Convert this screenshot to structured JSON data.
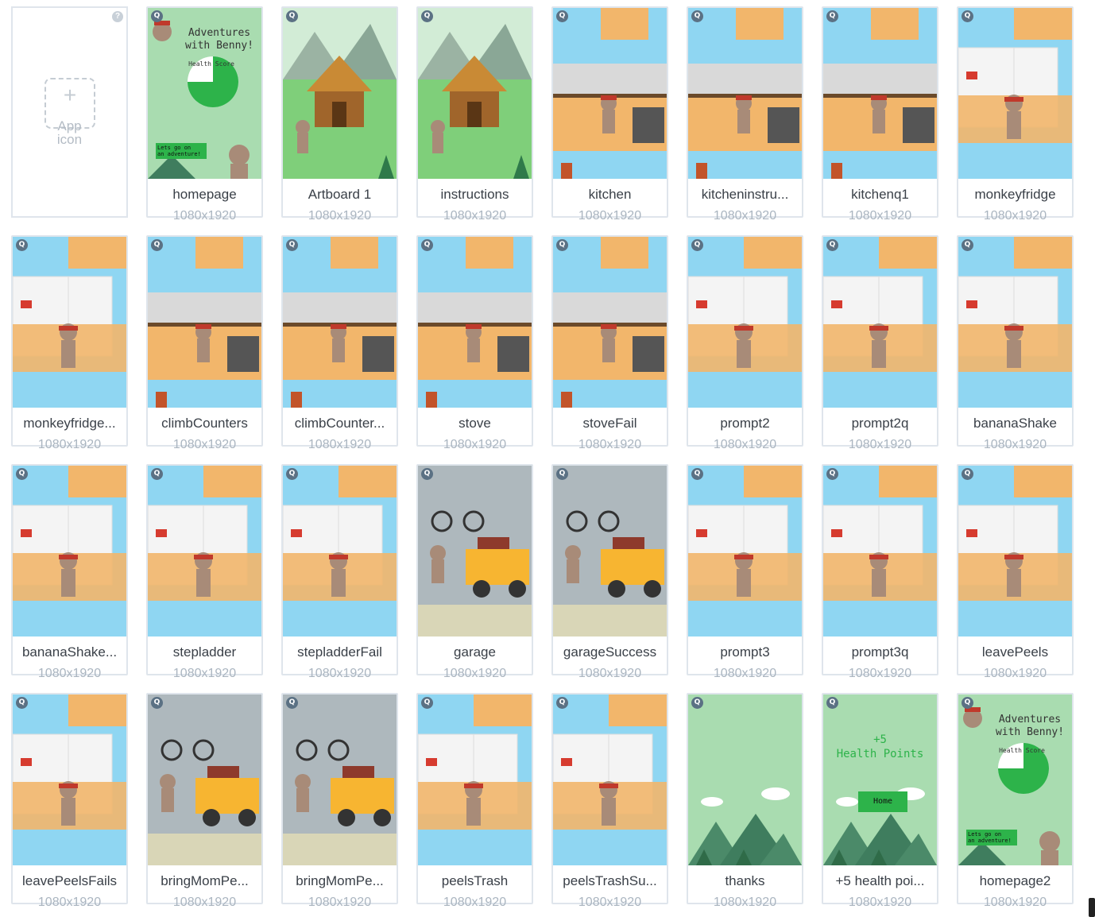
{
  "app_icon": {
    "label_line1": "App",
    "label_line2": "icon",
    "help": "?",
    "plus": "+"
  },
  "badge": "Q",
  "size_label": "1080x1920",
  "screens": [
    {
      "name": "homepage",
      "scene": "title"
    },
    {
      "name": "Artboard 1",
      "scene": "hut"
    },
    {
      "name": "instructions",
      "scene": "hut"
    },
    {
      "name": "kitchen",
      "scene": "kitchen"
    },
    {
      "name": "kitcheninstru...",
      "scene": "kitchen"
    },
    {
      "name": "kitchenq1",
      "scene": "kitchen"
    },
    {
      "name": "monkeyfridge",
      "scene": "fridge"
    },
    {
      "name": "monkeyfridge...",
      "scene": "fridge"
    },
    {
      "name": "climbCounters",
      "scene": "kitchen"
    },
    {
      "name": "climbCounter...",
      "scene": "kitchen"
    },
    {
      "name": "stove",
      "scene": "kitchen"
    },
    {
      "name": "stoveFail",
      "scene": "kitchen"
    },
    {
      "name": "prompt2",
      "scene": "fridge"
    },
    {
      "name": "prompt2q",
      "scene": "fridge"
    },
    {
      "name": "bananaShake",
      "scene": "fridge"
    },
    {
      "name": "bananaShake...",
      "scene": "fridge"
    },
    {
      "name": "stepladder",
      "scene": "fridge"
    },
    {
      "name": "stepladderFail",
      "scene": "fridge"
    },
    {
      "name": "garage",
      "scene": "garage"
    },
    {
      "name": "garageSuccess",
      "scene": "garage"
    },
    {
      "name": "prompt3",
      "scene": "fridge"
    },
    {
      "name": "prompt3q",
      "scene": "fridge"
    },
    {
      "name": "leavePeels",
      "scene": "fridge"
    },
    {
      "name": "leavePeelsFails",
      "scene": "fridge"
    },
    {
      "name": "bringMomPe...",
      "scene": "garage"
    },
    {
      "name": "bringMomPe...",
      "scene": "garage"
    },
    {
      "name": "peelsTrash",
      "scene": "fridge"
    },
    {
      "name": "peelsTrashSu...",
      "scene": "fridge"
    },
    {
      "name": "thanks",
      "scene": "mountain"
    },
    {
      "name": "+5 health poi...",
      "scene": "mountain"
    },
    {
      "name": "homepage2",
      "scene": "title"
    }
  ],
  "thumb_text": {
    "title_line1": "Adventures",
    "title_line2": "with Benny!",
    "health_score": "Health Score",
    "adventure_line1": "Lets go on",
    "adventure_line2": "an adventure!",
    "health_points_line1": "+5",
    "health_points_line2": "Health Points",
    "home_button": "Home"
  },
  "colors": {
    "sky": "#8fd6f2",
    "grass": "#7fcf7a",
    "cabinet": "#f2b66b",
    "wall_tile": "#d9d9d9",
    "garage_bg": "#aeb8bd",
    "car": "#f7b531",
    "title_bg": "#a9dcb0",
    "pie_green": "#2db34a"
  }
}
